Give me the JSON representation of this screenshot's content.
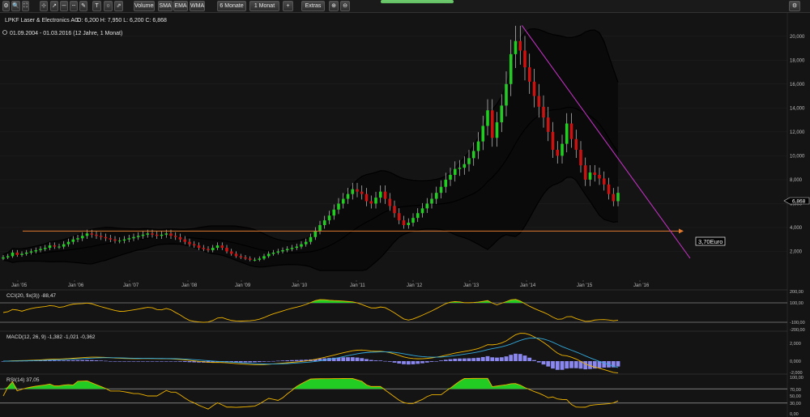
{
  "toolbar": {
    "buttons": [
      {
        "name": "gear-icon",
        "label": "⚙"
      },
      {
        "name": "zoom-icon",
        "label": "🔍"
      },
      {
        "name": "fit-icon",
        "label": "⛶"
      },
      {
        "name": "cursor-tool-icon",
        "label": "⊹"
      },
      {
        "name": "line-tool-icon",
        "label": "↗"
      },
      {
        "name": "hline-tool-icon",
        "label": "─"
      },
      {
        "name": "dotted-line-tool-icon",
        "label": "┄"
      },
      {
        "name": "pen-tool-icon",
        "label": "✎"
      },
      {
        "name": "text-tool-icon",
        "label": "T"
      },
      {
        "name": "circle-tool-icon",
        "label": "○"
      },
      {
        "name": "arrow-tool-icon",
        "label": "⇗"
      },
      {
        "name": "volume-button",
        "label": "Volumen"
      },
      {
        "name": "sma-button",
        "label": "SMA"
      },
      {
        "name": "ema-button",
        "label": "EMA"
      },
      {
        "name": "wma-button",
        "label": "WMA"
      },
      {
        "name": "period-select",
        "label": "6 Monate"
      },
      {
        "name": "interval-select",
        "label": "1 Monat"
      },
      {
        "name": "add-button",
        "label": "+"
      },
      {
        "name": "extras-button",
        "label": "Extras"
      },
      {
        "name": "zoom-in-icon",
        "label": "⊕"
      },
      {
        "name": "zoom-out-icon",
        "label": "⊖"
      }
    ],
    "right_icon": "settings-icon"
  },
  "header": {
    "instrument": "LPKF Laser & Electronics AG",
    "ohlc": "O: 6,200  H: 7,950  L: 6,200  C: 6,868",
    "range": "01.09.2004 - 01.03.2016 (12 Jahre, 1 Monat)"
  },
  "price_axis": {
    "ticks": [
      "20,000",
      "18,000",
      "16,000",
      "14,000",
      "12,000",
      "10,000",
      "8,000",
      "6,000",
      "4,000",
      "2,000"
    ],
    "current": "6,868"
  },
  "x_axis": {
    "labels": [
      "Jan '05",
      "Jan '06",
      "Jan '07",
      "Jan '08",
      "Jan '09",
      "Jan '10",
      "Jan '11",
      "Jan '12",
      "Jan '13",
      "Jan '14",
      "Jan '15",
      "Jan '16"
    ]
  },
  "annotation": {
    "label": "3,70Euro"
  },
  "colors": {
    "up": "#22cc22",
    "down": "#cc1111",
    "bb": "#000000",
    "trend": "#cc33cc",
    "hline": "#e07a30",
    "bg": "#141414"
  },
  "cci": {
    "title": "CCI(20, fix(3)) -88,47",
    "ticks": [
      "200,00",
      "100,00",
      "-100,00",
      "-200,00"
    ]
  },
  "macd": {
    "title": "MACD(12, 26, 9) -1,382  -1,021  -0,362",
    "ticks": [
      "2,000",
      "0,000",
      "-2,000"
    ]
  },
  "rsi": {
    "title": "RSI(14) 37,05",
    "ticks": [
      "100,00",
      "70,00",
      "50,00",
      "30,00",
      "0,00"
    ]
  },
  "chart_data": {
    "type": "candlestick",
    "title": "LPKF Laser & Electronics AG",
    "ylim": [
      0,
      21
    ],
    "x_start": 2004.67,
    "close": [
      1.5,
      1.6,
      1.9,
      1.7,
      1.8,
      1.9,
      2.0,
      2.1,
      2.2,
      2.3,
      2.5,
      2.4,
      2.4,
      2.6,
      2.8,
      3.0,
      3.1,
      3.3,
      3.5,
      3.4,
      3.3,
      3.2,
      3.1,
      3.0,
      2.9,
      2.9,
      3.0,
      3.1,
      3.2,
      3.3,
      3.4,
      3.5,
      3.4,
      3.3,
      3.4,
      3.5,
      3.3,
      3.2,
      3.0,
      2.8,
      2.6,
      2.5,
      2.3,
      2.2,
      2.1,
      2.3,
      2.5,
      2.3,
      2.0,
      1.8,
      1.6,
      1.5,
      1.4,
      1.3,
      1.3,
      1.4,
      1.6,
      1.8,
      1.9,
      2.0,
      2.1,
      2.2,
      2.3,
      2.4,
      2.6,
      2.8,
      3.2,
      3.7,
      4.2,
      4.6,
      5.0,
      5.5,
      6.0,
      6.4,
      6.8,
      7.2,
      7.0,
      6.8,
      6.2,
      6.0,
      6.5,
      7.0,
      6.4,
      5.8,
      5.2,
      4.6,
      4.2,
      4.4,
      4.8,
      5.2,
      5.6,
      6.0,
      6.4,
      6.9,
      7.4,
      8.0,
      8.4,
      8.9,
      9.0,
      9.3,
      9.8,
      10.4,
      11.2,
      12.5,
      13.8,
      11.5,
      12.8,
      14.2,
      16.0,
      18.5,
      19.6,
      18.8,
      17.4,
      16.2,
      15.0,
      14.1,
      13.2,
      12.0,
      10.5,
      10.0,
      11.0,
      12.7,
      11.4,
      10.5,
      9.2,
      8.0,
      8.6,
      8.4,
      8.1,
      7.6,
      6.8,
      6.2,
      6.9
    ],
    "open": [
      1.4,
      1.5,
      1.6,
      1.9,
      1.7,
      1.8,
      1.9,
      2.0,
      2.1,
      2.2,
      2.3,
      2.5,
      2.4,
      2.4,
      2.6,
      2.8,
      3.0,
      3.1,
      3.3,
      3.5,
      3.4,
      3.3,
      3.2,
      3.1,
      3.0,
      2.9,
      2.9,
      3.0,
      3.1,
      3.2,
      3.3,
      3.4,
      3.5,
      3.4,
      3.3,
      3.4,
      3.5,
      3.3,
      3.2,
      3.0,
      2.8,
      2.6,
      2.5,
      2.3,
      2.2,
      2.1,
      2.3,
      2.5,
      2.3,
      2.0,
      1.8,
      1.6,
      1.5,
      1.4,
      1.3,
      1.3,
      1.4,
      1.6,
      1.8,
      1.9,
      2.0,
      2.1,
      2.2,
      2.3,
      2.4,
      2.6,
      2.8,
      3.2,
      3.7,
      4.2,
      4.6,
      5.0,
      5.5,
      6.0,
      6.4,
      6.8,
      7.2,
      7.0,
      6.8,
      6.2,
      6.0,
      6.5,
      7.0,
      6.4,
      5.8,
      5.2,
      4.6,
      4.2,
      4.4,
      4.8,
      5.2,
      5.6,
      6.0,
      6.4,
      6.9,
      7.4,
      8.0,
      8.4,
      8.9,
      9.0,
      9.3,
      9.8,
      10.4,
      11.2,
      12.5,
      13.8,
      11.5,
      12.8,
      14.2,
      16.0,
      18.5,
      19.6,
      18.8,
      17.4,
      16.2,
      15.0,
      14.1,
      13.2,
      12.0,
      10.5,
      10.0,
      11.0,
      12.7,
      11.4,
      10.5,
      9.2,
      8.0,
      8.6,
      8.4,
      8.1,
      7.6,
      6.8,
      6.2
    ],
    "hline_value": 3.7,
    "trendline": [
      {
        "x": 2013.95,
        "y": 20.9
      },
      {
        "x": 2016.6,
        "y": 2.6
      }
    ],
    "current_price": 6.868
  }
}
